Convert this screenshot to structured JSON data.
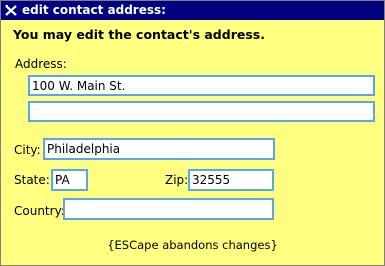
{
  "window": {
    "title": "edit contact address:",
    "icon": "close-x-icon"
  },
  "form": {
    "heading": "You may edit the contact's address.",
    "address_label": "Address:",
    "address_line1": "100 W. Main St.",
    "address_line2": "",
    "city_label": "City:",
    "city_value": "Philadelphia",
    "state_label": "State:",
    "state_value": "PA",
    "zip_label": "Zip:",
    "zip_value": "32555",
    "country_label": "Country:",
    "country_value": ""
  },
  "footer": {
    "hint": "{ESCape abandons changes}"
  },
  "colors": {
    "background": "#ffff80",
    "titlebar": "#000080",
    "field_border": "#5aa5f0"
  }
}
